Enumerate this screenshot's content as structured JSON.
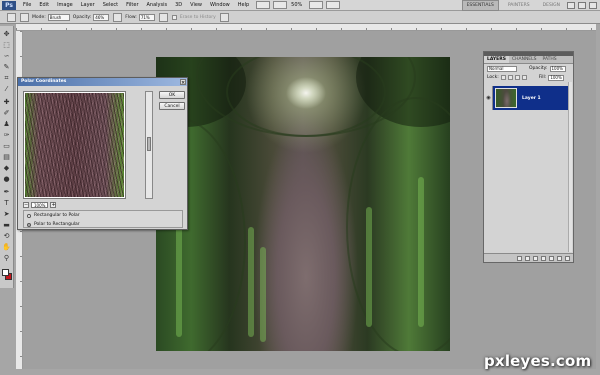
{
  "menubar": {
    "logo": "Ps",
    "items": [
      "File",
      "Edit",
      "Image",
      "Layer",
      "Select",
      "Filter",
      "Analysis",
      "3D",
      "View",
      "Window",
      "Help"
    ],
    "zoom": "50%",
    "workspaces": [
      "ESSENTIALS",
      "PAINTERS",
      "DESIGN"
    ]
  },
  "options": {
    "mode_label": "Mode:",
    "mode_value": "Brush",
    "opacity_label": "Opacity:",
    "opacity_value": "46%",
    "flow_label": "Flow:",
    "flow_value": "71%",
    "erase_label": "Erase to History"
  },
  "dialog": {
    "title": "Polar Coordinates",
    "ok_label": "OK",
    "cancel_label": "Cancel",
    "zoom_value": "100%",
    "option_rect_to_polar": "Rectangular to Polar",
    "option_polar_to_rect": "Polar to Rectangular",
    "selected_option": "Polar to Rectangular"
  },
  "layers": {
    "tabs": [
      "LAYERS",
      "CHANNELS",
      "PATHS"
    ],
    "blend_mode": "Normal",
    "opacity_label": "Opacity:",
    "opacity_value": "100%",
    "lock_label": "Lock:",
    "fill_label": "Fill:",
    "fill_value": "100%",
    "layer_name": "Layer 1"
  },
  "colors": {
    "foreground": "#ffffff",
    "background": "#c4161c",
    "selected_layer": "#0f2f8a"
  },
  "watermark": "pxleyes.com"
}
